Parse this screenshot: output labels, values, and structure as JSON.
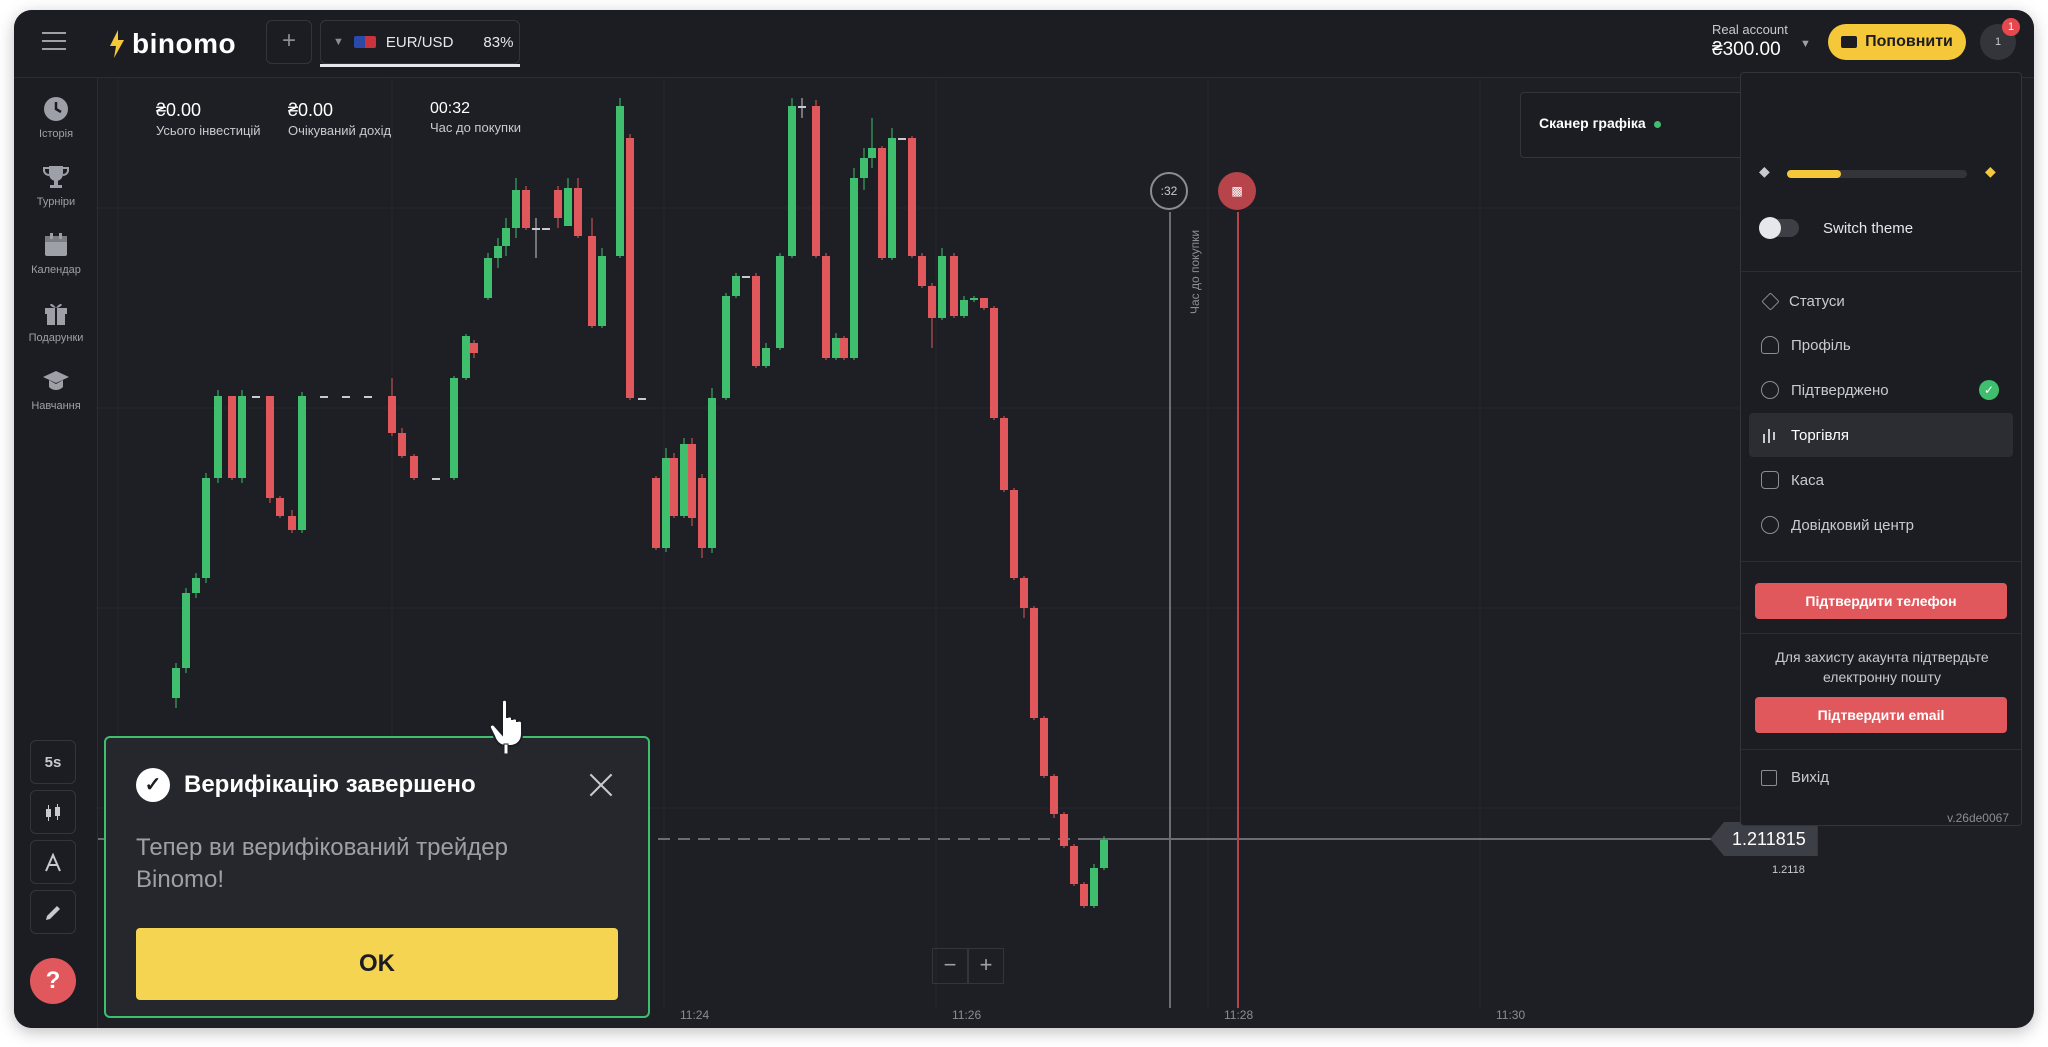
{
  "header": {
    "logo_text": "binomo",
    "add_tab_label": "+",
    "asset": {
      "name": "EUR/USD",
      "payout": "83%"
    },
    "account": {
      "label": "Real account",
      "balance": "₴300.00"
    },
    "deposit_label": "Поповнити",
    "avatar_initial": "1",
    "notification_count": "1"
  },
  "sidebar": {
    "items": [
      {
        "label": "Історія",
        "icon": "clock-icon"
      },
      {
        "label": "Турніри",
        "icon": "trophy-icon"
      },
      {
        "label": "Календар",
        "icon": "calendar-icon"
      },
      {
        "label": "Подарунки",
        "icon": "gift-icon"
      },
      {
        "label": "Навчання",
        "icon": "graduation-cap-icon"
      }
    ],
    "tools": {
      "timeframe": "5s"
    },
    "help_label": "?"
  },
  "stats": {
    "investments_value": "₴0.00",
    "investments_label": "Усього інвестицій",
    "income_value": "₴0.00",
    "income_label": "Очікуваний дохід",
    "time_value": "00:32",
    "time_label": "Час до покупки"
  },
  "chart": {
    "scanner_label": "Сканер графіка",
    "timer_circle": ":32",
    "timer_vertical_label": "Час до покупки",
    "current_price": "1.211815",
    "price_level_label": "1.2118",
    "time_labels": [
      "11:24",
      "11:26",
      "11:28",
      "11:30"
    ],
    "zoom_minus": "−",
    "zoom_plus": "+",
    "colors": {
      "up": "#3fbf6e",
      "down": "#e0585c",
      "background": "#1e1f24"
    }
  },
  "chart_data": {
    "type": "candlestick",
    "x": [
      "11:24",
      "11:26",
      "11:28",
      "11:30"
    ],
    "current_price": 1.211815
  },
  "dropdown": {
    "status_progress": 0.3,
    "switch_theme_label": "Switch theme",
    "menu": [
      {
        "label": "Статуси",
        "icon": "diamond-icon"
      },
      {
        "label": "Профіль",
        "icon": "user-icon"
      },
      {
        "label": "Підтверджено",
        "icon": "check-circle-icon"
      },
      {
        "label": "Торгівля",
        "icon": "chart-bars-icon"
      },
      {
        "label": "Каса",
        "icon": "wallet-icon"
      },
      {
        "label": "Довідковий центр",
        "icon": "info-icon"
      }
    ],
    "confirm_phone_label": "Підтвердити телефон",
    "email_note": "Для захисту акаунта підтвердьте електронну пошту",
    "confirm_email_label": "Підтвердити email",
    "logout_label": "Вихід",
    "version": "v.26de0067"
  },
  "modal": {
    "title": "Верифікацію завершено",
    "body": "Тепер ви верифікований трейдер Binomo!",
    "ok_label": "OK"
  }
}
